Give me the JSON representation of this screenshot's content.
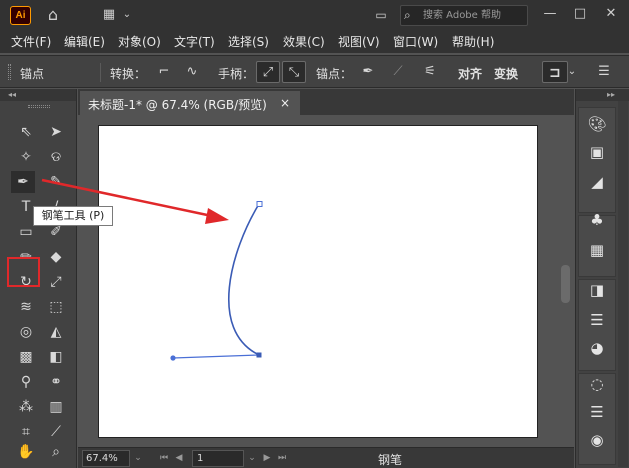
{
  "titlebar": {
    "logo": "Ai",
    "icons": [
      "home-icon",
      "layout-switcher-icon",
      "chevron-down-icon",
      "window-arrange-icon"
    ],
    "search": {
      "placeholder": "搜索 Adobe 帮助"
    },
    "window_controls": [
      "minimize-icon",
      "maximize-icon",
      "close-icon"
    ]
  },
  "menubar": {
    "items": [
      {
        "label": "文件(F)"
      },
      {
        "label": "编辑(E)"
      },
      {
        "label": "对象(O)"
      },
      {
        "label": "文字(T)"
      },
      {
        "label": "选择(S)"
      },
      {
        "label": "效果(C)"
      },
      {
        "label": "视图(V)"
      },
      {
        "label": "窗口(W)"
      },
      {
        "label": "帮助(H)"
      }
    ]
  },
  "controlbar": {
    "anchor_label": "锚点",
    "convert_label": "转换：",
    "handles_label": "手柄：",
    "anchors_label": "锚点：",
    "align_label": "对齐",
    "transform_label": "变换"
  },
  "document": {
    "tab_title": "未标题-1* @ 67.4% (RGB/预览)",
    "close_glyph": "×"
  },
  "tooltip": {
    "text": "钢笔工具 (P)"
  },
  "statusbar": {
    "zoom": "67.4%",
    "page": "1",
    "current_tool": "钢笔"
  },
  "tools": [
    "selection-tool",
    "direct-selection-tool",
    "magic-wand-tool",
    "lasso-tool",
    "pen-tool",
    "curvature-tool",
    "type-tool",
    "line-segment-tool",
    "rectangle-tool",
    "paintbrush-tool",
    "shaper-tool",
    "eraser-tool",
    "rotate-tool",
    "scale-tool",
    "warp-tool",
    "free-transform-tool",
    "shape-builder-tool",
    "perspective-grid-tool",
    "mesh-tool",
    "gradient-tool",
    "eyedropper-tool",
    "blend-tool",
    "symbol-sprayer-tool",
    "column-graph-tool",
    "artboard-tool",
    "slice-tool",
    "hand-tool",
    "zoom-tool"
  ],
  "right_panel": [
    "color-palette-icon",
    "color-guide-icon",
    "gradient-swatches-icon",
    "symbols-club-icon",
    "swatches-grid-icon",
    "gradient-icon",
    "stroke-lines-icon",
    "transparency-icon",
    "appearance-icon",
    "align-lines-icon",
    "pathfinder-icon"
  ],
  "colors": {
    "accent_red": "#e0282a",
    "path_blue": "#4a6fd6"
  }
}
